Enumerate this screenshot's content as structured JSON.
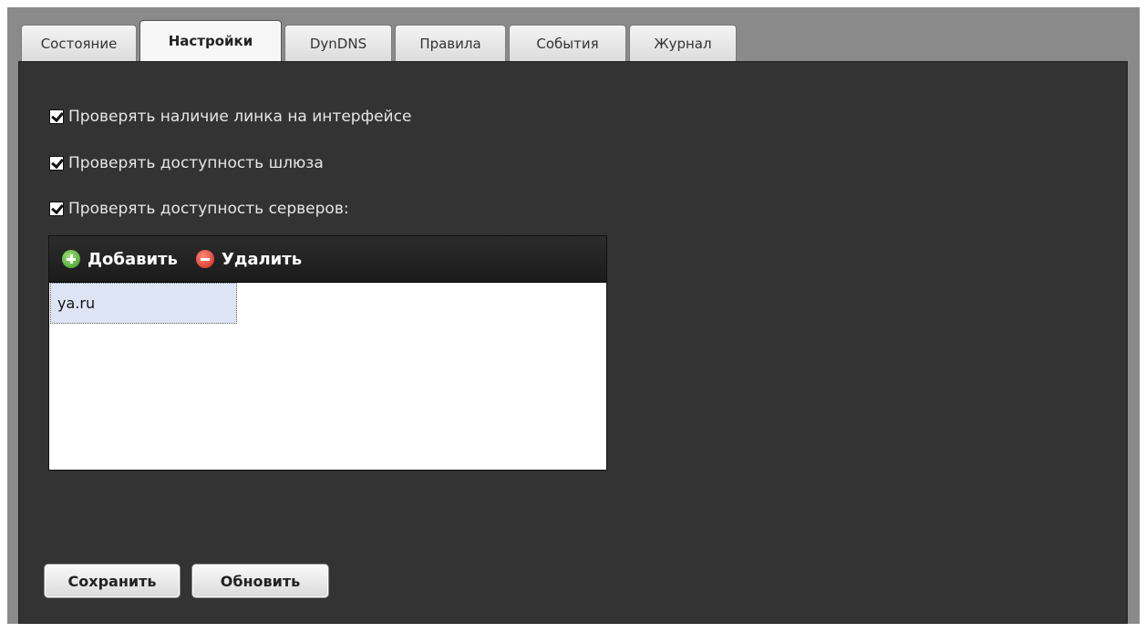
{
  "tabs": [
    {
      "label": "Состояние",
      "active": false
    },
    {
      "label": "Настройки",
      "active": true
    },
    {
      "label": "DynDNS",
      "active": false
    },
    {
      "label": "Правила",
      "active": false
    },
    {
      "label": "События",
      "active": false
    },
    {
      "label": "Журнал",
      "active": false
    }
  ],
  "settings": {
    "check_link": {
      "label": "Проверять наличие линка на интерфейсе",
      "checked": true
    },
    "check_gateway": {
      "label": "Проверять доступность шлюза",
      "checked": true
    },
    "check_servers": {
      "label": "Проверять доступность серверов:",
      "checked": true
    }
  },
  "servers": {
    "add_label": "Добавить",
    "delete_label": "Удалить",
    "items": [
      "ya.ru"
    ]
  },
  "actions": {
    "save_label": "Сохранить",
    "refresh_label": "Обновить"
  },
  "icons": {
    "add": "plus-circle-icon",
    "delete": "minus-circle-icon",
    "checkbox": "checkbox-checked-icon"
  }
}
